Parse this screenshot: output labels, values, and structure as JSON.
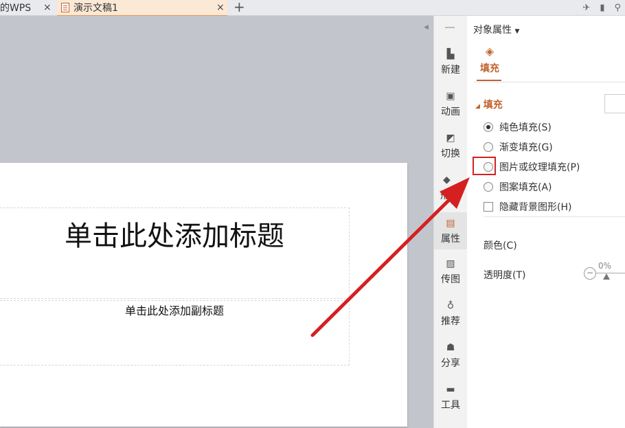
{
  "tabs": [
    {
      "label": "的WPS",
      "close": "×"
    },
    {
      "label": "演示文稿1",
      "close": "×"
    }
  ],
  "add_tab": "+",
  "slide": {
    "title_placeholder": "单击此处添加标题",
    "subtitle_placeholder": "单击此处添加副标题"
  },
  "sidebar": {
    "items": [
      {
        "label": "新建",
        "icon": "new-file-icon"
      },
      {
        "label": "动画",
        "icon": "animation-icon"
      },
      {
        "label": "切换",
        "icon": "transition-icon"
      },
      {
        "label": "形",
        "icon": "shape-icon"
      },
      {
        "label": "属性",
        "icon": "properties-icon"
      },
      {
        "label": "传图",
        "icon": "upload-image-icon"
      },
      {
        "label": "推荐",
        "icon": "recommend-icon"
      },
      {
        "label": "分享",
        "icon": "share-icon"
      },
      {
        "label": "工具",
        "icon": "toolbox-icon"
      }
    ]
  },
  "panel": {
    "title": "对象属性",
    "fill_tab": "填充",
    "section": "填充",
    "options": [
      {
        "label": "纯色填充(S)",
        "type": "radio",
        "checked": true
      },
      {
        "label": "渐变填充(G)",
        "type": "radio",
        "checked": false
      },
      {
        "label": "图片或纹理填充(P)",
        "type": "radio",
        "checked": false
      },
      {
        "label": "图案填充(A)",
        "type": "radio",
        "checked": false
      },
      {
        "label": "隐藏背景图形(H)",
        "type": "checkbox",
        "checked": false
      }
    ],
    "color_label": "颜色(C)",
    "transparency_label": "透明度(T)",
    "transparency_value": "0%"
  },
  "colors": {
    "accent": "#c0612b",
    "annotation": "#d42020"
  }
}
